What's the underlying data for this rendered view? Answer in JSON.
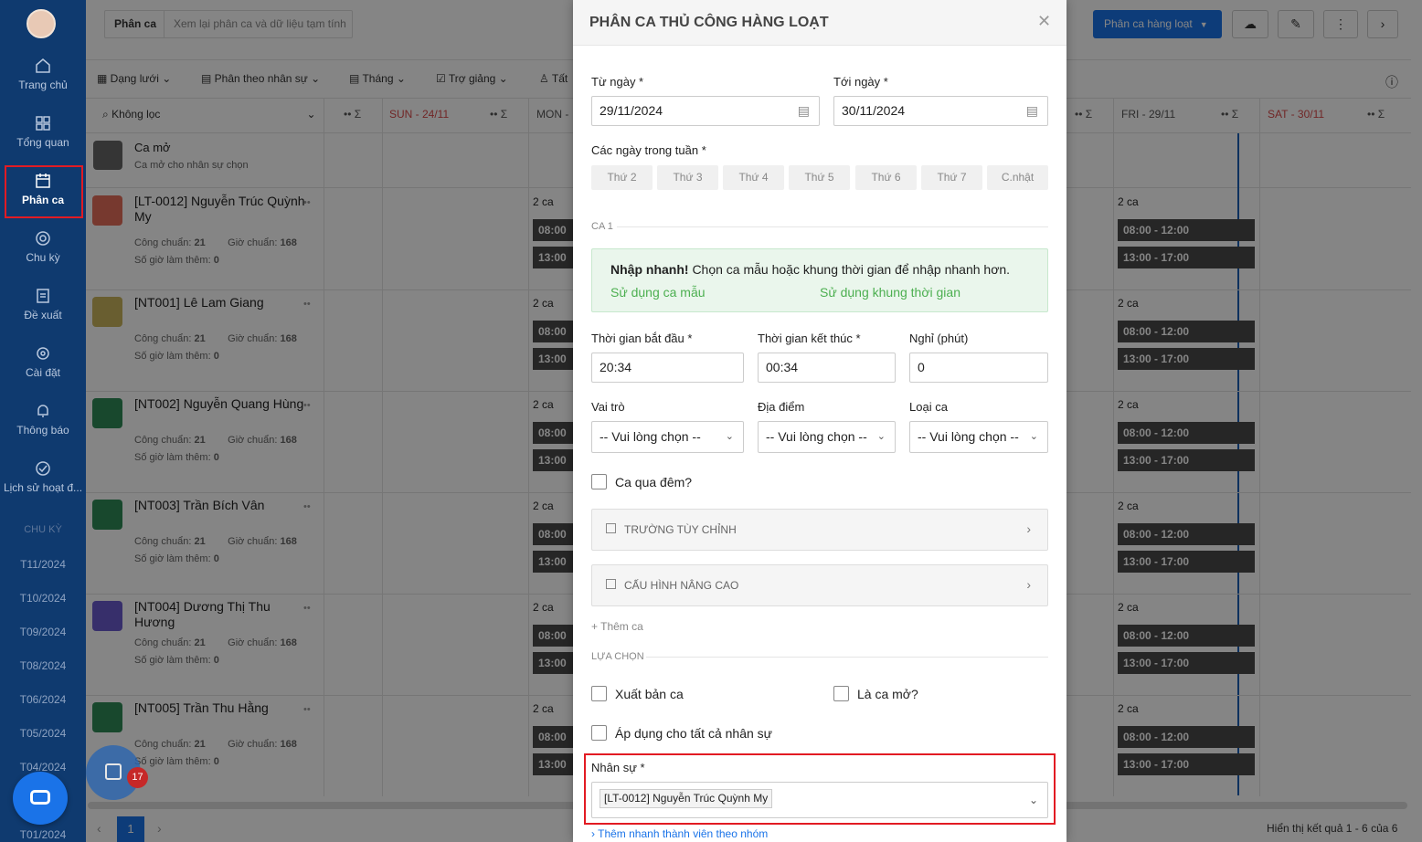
{
  "sidebar": {
    "nav": [
      {
        "label": "Trang chủ",
        "icon": "home-icon"
      },
      {
        "label": "Tổng quan",
        "icon": "grid-icon"
      },
      {
        "label": "Phân ca",
        "icon": "calendar-icon"
      },
      {
        "label": "Chu kỳ",
        "icon": "cycle-icon"
      },
      {
        "label": "Đề xuất",
        "icon": "document-icon"
      },
      {
        "label": "Cài đặt",
        "icon": "gear-icon"
      },
      {
        "label": "Thông báo",
        "icon": "bell-icon"
      },
      {
        "label": "Lịch sử hoạt đ...",
        "icon": "check-circle-icon"
      }
    ],
    "periods_label": "CHU KỲ",
    "periods": [
      "T11/2024",
      "T10/2024",
      "T09/2024",
      "T08/2024",
      "T06/2024",
      "T05/2024",
      "T04/2024",
      "T01/2024"
    ],
    "badge": "17"
  },
  "header": {
    "tab": "Phân ca",
    "tab_desc": "Xem lại phân ca và dữ liệu tạm tính",
    "bulk_button": "Phân ca hàng loạt"
  },
  "filters": {
    "view": "Dạng lưới",
    "group": "Phân theo nhân sự",
    "period": "Tháng",
    "role": "Trợ giảng",
    "more": "Tất",
    "no_filter": "Không lọc"
  },
  "days": [
    "SUN - 24/11",
    "MON -",
    "FRI - 29/11",
    "SAT - 30/11"
  ],
  "open_shift": {
    "title": "Ca mở",
    "desc": "Ca mở cho nhân sự chọn"
  },
  "employees": [
    {
      "name": "[LT-0012] Nguyễn Trúc Quỳnh My",
      "std_label": "Công chuẩn:",
      "std": "21",
      "hours_label": "Giờ chuẩn:",
      "hours": "168",
      "ot_label": "Số giờ làm thêm:",
      "ot": "0"
    },
    {
      "name": "[NT001] Lê Lam Giang",
      "std_label": "Công chuẩn:",
      "std": "21",
      "hours_label": "Giờ chuẩn:",
      "hours": "168",
      "ot_label": "Số giờ làm thêm:",
      "ot": "0"
    },
    {
      "name": "[NT002] Nguyễn Quang Hùng",
      "std_label": "Công chuẩn:",
      "std": "21",
      "hours_label": "Giờ chuẩn:",
      "hours": "168",
      "ot_label": "Số giờ làm thêm:",
      "ot": "0"
    },
    {
      "name": "[NT003] Trần Bích Vân",
      "std_label": "Công chuẩn:",
      "std": "21",
      "hours_label": "Giờ chuẩn:",
      "hours": "168",
      "ot_label": "Số giờ làm thêm:",
      "ot": "0"
    },
    {
      "name": "[NT004] Dương Thị Thu Hương",
      "std_label": "Công chuẩn:",
      "std": "21",
      "hours_label": "Giờ chuẩn:",
      "hours": "168",
      "ot_label": "Số giờ làm thêm:",
      "ot": "0"
    },
    {
      "name": "[NT005] Trần Thu Hằng",
      "std_label": "Công chuẩn:",
      "std": "21",
      "hours_label": "Giờ chuẩn:",
      "hours": "168",
      "ot_label": "Số giờ làm thêm:",
      "ot": "0"
    }
  ],
  "grid": {
    "count": "2 ca",
    "shift_a": "08:00 - 12:00",
    "shift_b": "13:00 - 17:00",
    "shift_a_short": "08:00",
    "shift_b_short": "13:00"
  },
  "pagination": {
    "page": "1",
    "result": "Hiển thị kết quả 1 - 6 của 6"
  },
  "modal": {
    "title": "PHÂN CA THỦ CÔNG HÀNG LOẠT",
    "from_label": "Từ ngày *",
    "from_value": "29/11/2024",
    "to_label": "Tới ngày *",
    "to_value": "30/11/2024",
    "weekdays_label": "Các ngày trong tuần *",
    "weekdays": [
      "Thứ 2",
      "Thứ 3",
      "Thứ 4",
      "Thứ 5",
      "Thứ 6",
      "Thứ 7",
      "C.nhật"
    ],
    "section_shift": "CA 1",
    "quick_title": "Nhập nhanh!",
    "quick_text": "Chọn ca mẫu hoặc khung thời gian để nhập nhanh hơn.",
    "quick_link1": "Sử dụng ca mẫu",
    "quick_link2": "Sử dụng khung thời gian",
    "start_label": "Thời gian bắt đầu *",
    "start_value": "20:34",
    "end_label": "Thời gian kết thúc *",
    "end_value": "00:34",
    "break_label": "Nghỉ (phút)",
    "break_value": "0",
    "role_label": "Vai trò",
    "location_label": "Địa điểm",
    "type_label": "Loại ca",
    "select_placeholder": "-- Vui lòng chọn --",
    "overnight_label": "Ca qua đêm?",
    "custom_fields": "TRƯỜNG TÙY CHỈNH",
    "advanced": "CẤU HÌNH NÂNG CAO",
    "add_shift": "+ Thêm ca",
    "section_options": "LỰA CHỌN",
    "publish_label": "Xuất bản ca",
    "open_label": "Là ca mở?",
    "apply_all_label": "Áp dụng cho tất cả nhân sự",
    "staff_label": "Nhân sự *",
    "staff_tag": "[LT-0012] Nguyễn Trúc Quỳnh My",
    "add_group_link": "› Thêm nhanh thành viên theo nhóm"
  }
}
